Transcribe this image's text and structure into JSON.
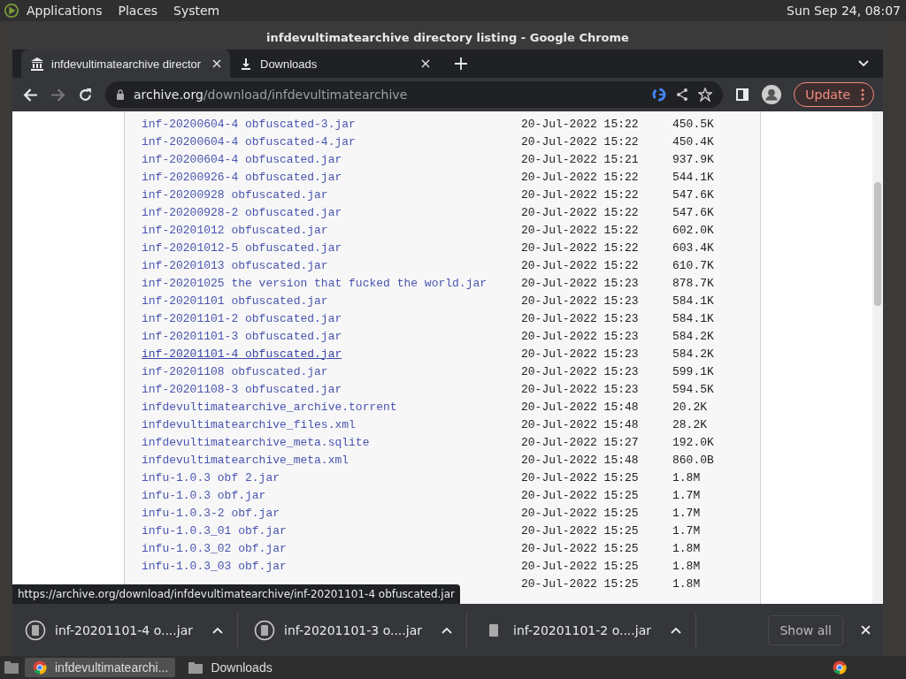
{
  "top_panel": {
    "menus": [
      "Applications",
      "Places",
      "System"
    ],
    "clock": "Sun Sep 24, 08:07"
  },
  "window": {
    "title": "infdevultimatearchive directory listing - Google Chrome"
  },
  "tabs": [
    {
      "label": "infdevultimatearchive director",
      "kind": "archive",
      "selected": true
    },
    {
      "label": "Downloads",
      "kind": "download",
      "selected": false
    }
  ],
  "address": {
    "host": "archive.org",
    "path": "/download/infdevultimatearchive"
  },
  "update_button": "Update",
  "files": [
    {
      "name": "inf-20200604-4 obfuscated-3.jar",
      "date": "20-Jul-2022 15:22",
      "size": "450.5K",
      "hovered": false
    },
    {
      "name": "inf-20200604-4 obfuscated-4.jar",
      "date": "20-Jul-2022 15:22",
      "size": "450.4K",
      "hovered": false
    },
    {
      "name": "inf-20200604-4 obfuscated.jar",
      "date": "20-Jul-2022 15:21",
      "size": "937.9K",
      "hovered": false
    },
    {
      "name": "inf-20200926-4 obfuscated.jar",
      "date": "20-Jul-2022 15:22",
      "size": "544.1K",
      "hovered": false
    },
    {
      "name": "inf-20200928 obfuscated.jar",
      "date": "20-Jul-2022 15:22",
      "size": "547.6K",
      "hovered": false
    },
    {
      "name": "inf-20200928-2 obfuscated.jar",
      "date": "20-Jul-2022 15:22",
      "size": "547.6K",
      "hovered": false
    },
    {
      "name": "inf-20201012 obfuscated.jar",
      "date": "20-Jul-2022 15:22",
      "size": "602.0K",
      "hovered": false
    },
    {
      "name": "inf-20201012-5 obfuscated.jar",
      "date": "20-Jul-2022 15:22",
      "size": "603.4K",
      "hovered": false
    },
    {
      "name": "inf-20201013 obfuscated.jar",
      "date": "20-Jul-2022 15:22",
      "size": "610.7K",
      "hovered": false
    },
    {
      "name": "inf-20201025 the version that fucked the world.jar",
      "date": "20-Jul-2022 15:23",
      "size": "878.7K",
      "hovered": false
    },
    {
      "name": "inf-20201101 obfuscated.jar",
      "date": "20-Jul-2022 15:23",
      "size": "584.1K",
      "hovered": false
    },
    {
      "name": "inf-20201101-2 obfuscated.jar",
      "date": "20-Jul-2022 15:23",
      "size": "584.1K",
      "hovered": false
    },
    {
      "name": "inf-20201101-3 obfuscated.jar",
      "date": "20-Jul-2022 15:23",
      "size": "584.2K",
      "hovered": false
    },
    {
      "name": "inf-20201101-4 obfuscated.jar",
      "date": "20-Jul-2022 15:23",
      "size": "584.2K",
      "hovered": true
    },
    {
      "name": "inf-20201108 obfuscated.jar",
      "date": "20-Jul-2022 15:23",
      "size": "599.1K",
      "hovered": false
    },
    {
      "name": "inf-20201108-3 obfuscated.jar",
      "date": "20-Jul-2022 15:23",
      "size": "594.5K",
      "hovered": false
    },
    {
      "name": "infdevultimatearchive_archive.torrent",
      "date": "20-Jul-2022 15:48",
      "size": "20.2K",
      "hovered": false
    },
    {
      "name": "infdevultimatearchive_files.xml",
      "date": "20-Jul-2022 15:48",
      "size": "28.2K",
      "hovered": false
    },
    {
      "name": "infdevultimatearchive_meta.sqlite",
      "date": "20-Jul-2022 15:27",
      "size": "192.0K",
      "hovered": false
    },
    {
      "name": "infdevultimatearchive_meta.xml",
      "date": "20-Jul-2022 15:48",
      "size": "860.0B",
      "hovered": false
    },
    {
      "name": "infu-1.0.3 obf 2.jar",
      "date": "20-Jul-2022 15:25",
      "size": "1.8M",
      "hovered": false
    },
    {
      "name": "infu-1.0.3 obf.jar",
      "date": "20-Jul-2022 15:25",
      "size": "1.7M",
      "hovered": false
    },
    {
      "name": "infu-1.0.3-2 obf.jar",
      "date": "20-Jul-2022 15:25",
      "size": "1.7M",
      "hovered": false
    },
    {
      "name": "infu-1.0.3_01 obf.jar",
      "date": "20-Jul-2022 15:25",
      "size": "1.7M",
      "hovered": false
    },
    {
      "name": "infu-1.0.3_02 obf.jar",
      "date": "20-Jul-2022 15:25",
      "size": "1.8M",
      "hovered": false
    },
    {
      "name": "infu-1.0.3_03 obf.jar",
      "date": "20-Jul-2022 15:25",
      "size": "1.8M",
      "hovered": false
    },
    {
      "date": "20-Jul-2022 15:25",
      "size": "1.8M"
    }
  ],
  "status_url": "https://archive.org/download/infdevultimatearchive/inf-20201101-4 obfuscated.jar",
  "downloads": [
    {
      "name": "inf-20201101-4 o....jar",
      "kind": "complete"
    },
    {
      "name": "inf-20201101-3 o....jar",
      "kind": "complete"
    },
    {
      "name": "inf-20201101-2 o....jar",
      "kind": "progress"
    }
  ],
  "show_all": "Show all",
  "taskbar": [
    {
      "label": "infdevultimatearchi...",
      "kind": "chrome",
      "selected": true
    },
    {
      "label": "Downloads",
      "kind": "folder",
      "selected": false
    }
  ]
}
